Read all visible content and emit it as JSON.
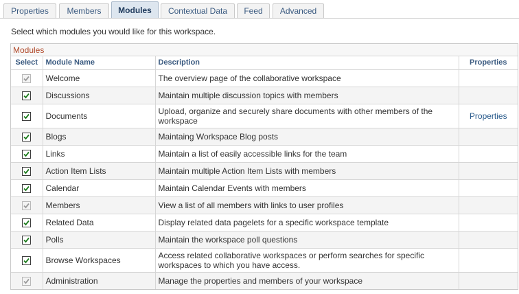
{
  "tabs": [
    {
      "label": "Properties",
      "active": false
    },
    {
      "label": "Members",
      "active": false
    },
    {
      "label": "Modules",
      "active": true
    },
    {
      "label": "Contextual Data",
      "active": false
    },
    {
      "label": "Feed",
      "active": false
    },
    {
      "label": "Advanced",
      "active": false
    }
  ],
  "instructions": "Select which modules you would like for this workspace.",
  "grid": {
    "title": "Modules",
    "headers": {
      "select": "Select",
      "module_name": "Module Name",
      "description": "Description",
      "properties": "Properties"
    },
    "rows": [
      {
        "name": "Welcome",
        "description": "The overview page of the collaborative workspace",
        "checked": true,
        "disabled": true,
        "properties": ""
      },
      {
        "name": "Discussions",
        "description": "Maintain multiple discussion topics with members",
        "checked": true,
        "disabled": false,
        "properties": ""
      },
      {
        "name": "Documents",
        "description": "Upload, organize and securely share documents with other members of the workspace",
        "checked": true,
        "disabled": false,
        "properties": "Properties"
      },
      {
        "name": "Blogs",
        "description": "Maintaing Workspace Blog posts",
        "checked": true,
        "disabled": false,
        "properties": ""
      },
      {
        "name": "Links",
        "description": "Maintain a list of easily accessible links for the team",
        "checked": true,
        "disabled": false,
        "properties": ""
      },
      {
        "name": "Action Item Lists",
        "description": "Maintain multiple Action Item Lists with members",
        "checked": true,
        "disabled": false,
        "properties": ""
      },
      {
        "name": "Calendar",
        "description": "Maintain Calendar Events with members",
        "checked": true,
        "disabled": false,
        "properties": ""
      },
      {
        "name": "Members",
        "description": "View a list of all members with links to user profiles",
        "checked": true,
        "disabled": true,
        "properties": ""
      },
      {
        "name": "Related Data",
        "description": "Display related data pagelets for a specific workspace template",
        "checked": true,
        "disabled": false,
        "properties": ""
      },
      {
        "name": "Polls",
        "description": "Maintain the workspace poll questions",
        "checked": true,
        "disabled": false,
        "properties": ""
      },
      {
        "name": "Browse Workspaces",
        "description": "Access related collaborative workspaces or perform searches for specific workspaces to which you have access.",
        "checked": true,
        "disabled": false,
        "properties": ""
      },
      {
        "name": "Administration",
        "description": "Manage the properties and members of your workspace",
        "checked": true,
        "disabled": true,
        "properties": ""
      }
    ]
  },
  "colors": {
    "accent": "#3a5a80",
    "grid_title": "#b14a2b",
    "checkmark": "#1a7a1a",
    "checkmark_disabled": "#9a9a9a"
  }
}
